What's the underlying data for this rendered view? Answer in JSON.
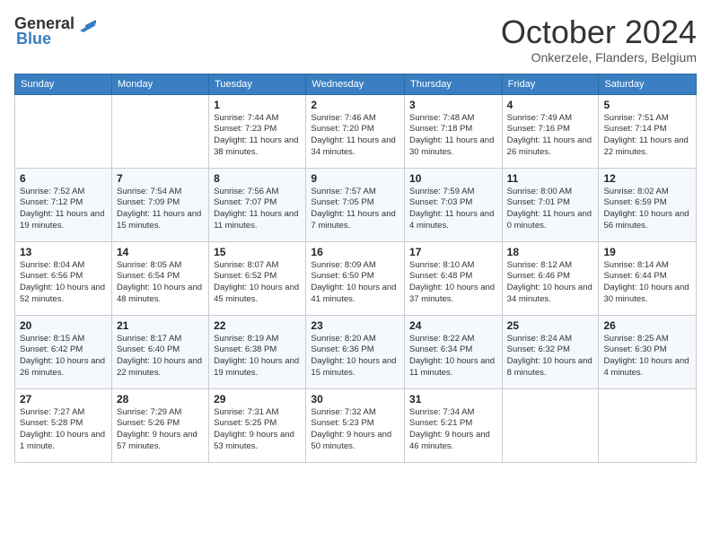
{
  "logo": {
    "general": "General",
    "blue": "Blue"
  },
  "header": {
    "month": "October 2024",
    "location": "Onkerzele, Flanders, Belgium"
  },
  "weekdays": [
    "Sunday",
    "Monday",
    "Tuesday",
    "Wednesday",
    "Thursday",
    "Friday",
    "Saturday"
  ],
  "weeks": [
    [
      {
        "day": "",
        "info": ""
      },
      {
        "day": "",
        "info": ""
      },
      {
        "day": "1",
        "info": "Sunrise: 7:44 AM\nSunset: 7:23 PM\nDaylight: 11 hours and 38 minutes."
      },
      {
        "day": "2",
        "info": "Sunrise: 7:46 AM\nSunset: 7:20 PM\nDaylight: 11 hours and 34 minutes."
      },
      {
        "day": "3",
        "info": "Sunrise: 7:48 AM\nSunset: 7:18 PM\nDaylight: 11 hours and 30 minutes."
      },
      {
        "day": "4",
        "info": "Sunrise: 7:49 AM\nSunset: 7:16 PM\nDaylight: 11 hours and 26 minutes."
      },
      {
        "day": "5",
        "info": "Sunrise: 7:51 AM\nSunset: 7:14 PM\nDaylight: 11 hours and 22 minutes."
      }
    ],
    [
      {
        "day": "6",
        "info": "Sunrise: 7:52 AM\nSunset: 7:12 PM\nDaylight: 11 hours and 19 minutes."
      },
      {
        "day": "7",
        "info": "Sunrise: 7:54 AM\nSunset: 7:09 PM\nDaylight: 11 hours and 15 minutes."
      },
      {
        "day": "8",
        "info": "Sunrise: 7:56 AM\nSunset: 7:07 PM\nDaylight: 11 hours and 11 minutes."
      },
      {
        "day": "9",
        "info": "Sunrise: 7:57 AM\nSunset: 7:05 PM\nDaylight: 11 hours and 7 minutes."
      },
      {
        "day": "10",
        "info": "Sunrise: 7:59 AM\nSunset: 7:03 PM\nDaylight: 11 hours and 4 minutes."
      },
      {
        "day": "11",
        "info": "Sunrise: 8:00 AM\nSunset: 7:01 PM\nDaylight: 11 hours and 0 minutes."
      },
      {
        "day": "12",
        "info": "Sunrise: 8:02 AM\nSunset: 6:59 PM\nDaylight: 10 hours and 56 minutes."
      }
    ],
    [
      {
        "day": "13",
        "info": "Sunrise: 8:04 AM\nSunset: 6:56 PM\nDaylight: 10 hours and 52 minutes."
      },
      {
        "day": "14",
        "info": "Sunrise: 8:05 AM\nSunset: 6:54 PM\nDaylight: 10 hours and 48 minutes."
      },
      {
        "day": "15",
        "info": "Sunrise: 8:07 AM\nSunset: 6:52 PM\nDaylight: 10 hours and 45 minutes."
      },
      {
        "day": "16",
        "info": "Sunrise: 8:09 AM\nSunset: 6:50 PM\nDaylight: 10 hours and 41 minutes."
      },
      {
        "day": "17",
        "info": "Sunrise: 8:10 AM\nSunset: 6:48 PM\nDaylight: 10 hours and 37 minutes."
      },
      {
        "day": "18",
        "info": "Sunrise: 8:12 AM\nSunset: 6:46 PM\nDaylight: 10 hours and 34 minutes."
      },
      {
        "day": "19",
        "info": "Sunrise: 8:14 AM\nSunset: 6:44 PM\nDaylight: 10 hours and 30 minutes."
      }
    ],
    [
      {
        "day": "20",
        "info": "Sunrise: 8:15 AM\nSunset: 6:42 PM\nDaylight: 10 hours and 26 minutes."
      },
      {
        "day": "21",
        "info": "Sunrise: 8:17 AM\nSunset: 6:40 PM\nDaylight: 10 hours and 22 minutes."
      },
      {
        "day": "22",
        "info": "Sunrise: 8:19 AM\nSunset: 6:38 PM\nDaylight: 10 hours and 19 minutes."
      },
      {
        "day": "23",
        "info": "Sunrise: 8:20 AM\nSunset: 6:36 PM\nDaylight: 10 hours and 15 minutes."
      },
      {
        "day": "24",
        "info": "Sunrise: 8:22 AM\nSunset: 6:34 PM\nDaylight: 10 hours and 11 minutes."
      },
      {
        "day": "25",
        "info": "Sunrise: 8:24 AM\nSunset: 6:32 PM\nDaylight: 10 hours and 8 minutes."
      },
      {
        "day": "26",
        "info": "Sunrise: 8:25 AM\nSunset: 6:30 PM\nDaylight: 10 hours and 4 minutes."
      }
    ],
    [
      {
        "day": "27",
        "info": "Sunrise: 7:27 AM\nSunset: 5:28 PM\nDaylight: 10 hours and 1 minute."
      },
      {
        "day": "28",
        "info": "Sunrise: 7:29 AM\nSunset: 5:26 PM\nDaylight: 9 hours and 57 minutes."
      },
      {
        "day": "29",
        "info": "Sunrise: 7:31 AM\nSunset: 5:25 PM\nDaylight: 9 hours and 53 minutes."
      },
      {
        "day": "30",
        "info": "Sunrise: 7:32 AM\nSunset: 5:23 PM\nDaylight: 9 hours and 50 minutes."
      },
      {
        "day": "31",
        "info": "Sunrise: 7:34 AM\nSunset: 5:21 PM\nDaylight: 9 hours and 46 minutes."
      },
      {
        "day": "",
        "info": ""
      },
      {
        "day": "",
        "info": ""
      }
    ]
  ]
}
